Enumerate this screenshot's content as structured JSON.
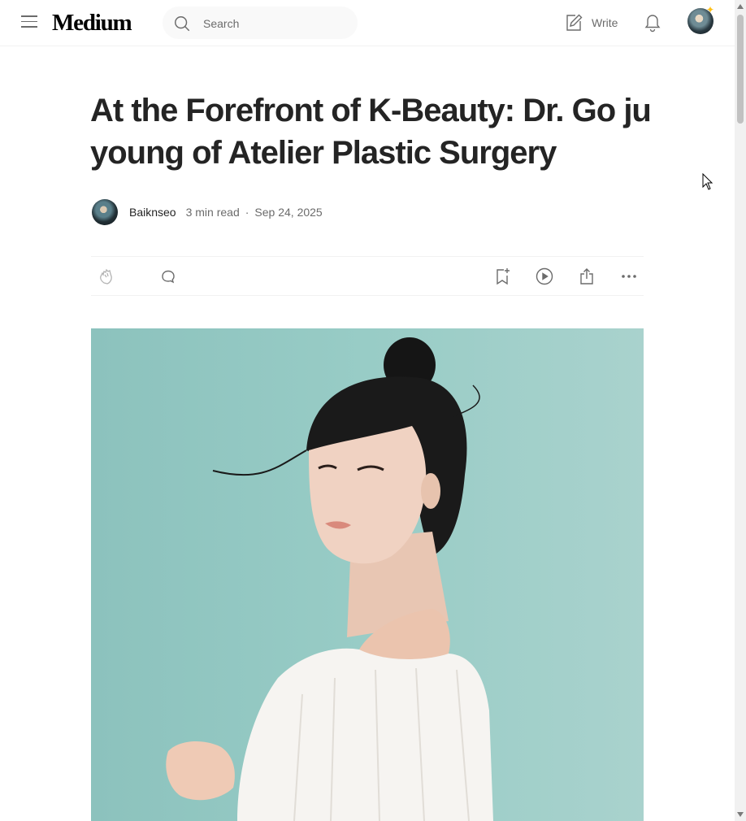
{
  "header": {
    "logo": "Medium",
    "search_placeholder": "Search",
    "write_label": "Write"
  },
  "article": {
    "title": "At the Forefront of K-Beauty: Dr. Go ju young of Atelier Plastic Surgery",
    "author": "Baiknseo",
    "read_time": "3 min read",
    "separator": "·",
    "date": "Sep 24, 2025"
  },
  "colors": {
    "text": "#242424",
    "muted": "#6b6b6b",
    "background": "#ffffff",
    "hero_background": "#98ccc6",
    "badge_star": "#ffc017"
  },
  "icons": {
    "menu": "menu-icon",
    "search": "search-icon",
    "write": "write-icon",
    "notifications": "bell-icon",
    "clap": "clap-icon",
    "comment": "comment-icon",
    "save": "bookmark-add-icon",
    "listen": "play-icon",
    "share": "share-icon",
    "more": "more-icon"
  }
}
